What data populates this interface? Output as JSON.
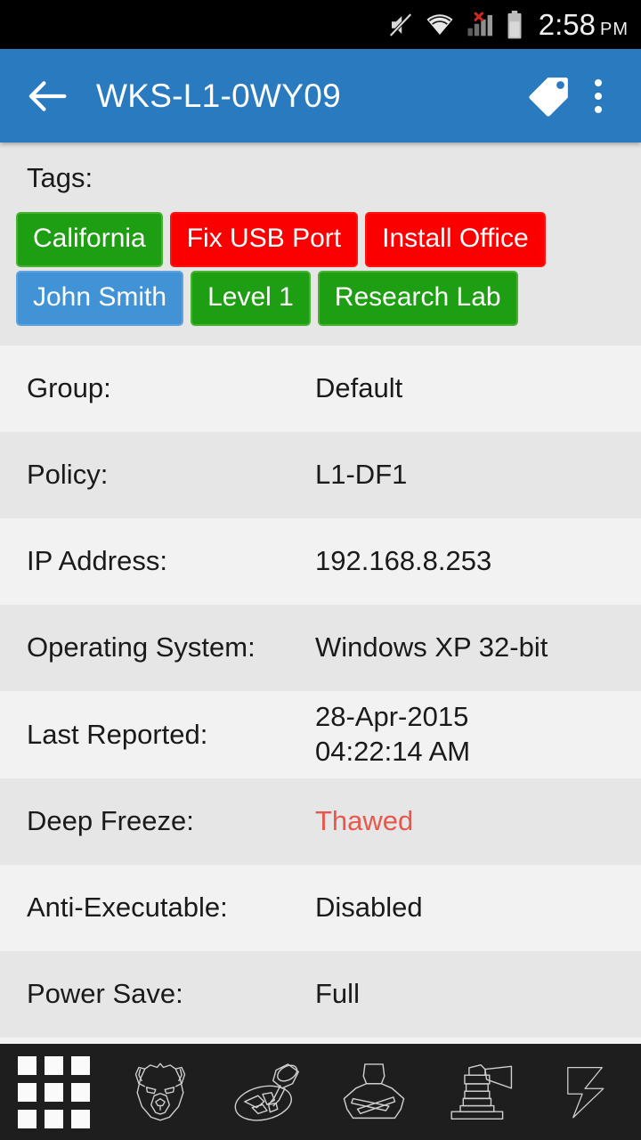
{
  "status_bar": {
    "time": "2:58",
    "meridiem": "PM",
    "icons": [
      "mute-icon",
      "wifi-icon",
      "cellular-no-service-icon",
      "battery-icon"
    ]
  },
  "app_bar": {
    "back_label": "back-arrow",
    "title": "WKS-L1-0WY09",
    "tag_action": "tag-icon",
    "overflow_action": "overflow-menu-icon"
  },
  "tags_section": {
    "label": "Tags:",
    "rows": [
      [
        {
          "text": "California",
          "color": "green"
        },
        {
          "text": "Fix USB Port",
          "color": "red"
        },
        {
          "text": "Install Office",
          "color": "red"
        }
      ],
      [
        {
          "text": "John Smith",
          "color": "blue"
        },
        {
          "text": "Level 1",
          "color": "green"
        },
        {
          "text": "Research Lab",
          "color": "green"
        }
      ]
    ],
    "colors": {
      "green": "#1e9e12",
      "red": "#fb0000",
      "blue": "#4292d6"
    }
  },
  "details": [
    {
      "label": "Group:",
      "value": "Default"
    },
    {
      "label": "Policy:",
      "value": "L1-DF1"
    },
    {
      "label": "IP Address:",
      "value": "192.168.8.253"
    },
    {
      "label": "Operating System:",
      "value": "Windows XP 32-bit"
    },
    {
      "label": "Last Reported:",
      "value": "28-Apr-2015\n04:22:14 AM"
    },
    {
      "label": "Deep Freeze:",
      "value": "Thawed",
      "status_color": "#e8574c"
    },
    {
      "label": "Anti-Executable:",
      "value": "Disabled"
    },
    {
      "label": "Power Save:",
      "value": "Full"
    }
  ],
  "bottom_bar": {
    "items": [
      {
        "icon": "apps-grid-icon"
      },
      {
        "icon": "bear-face-icon"
      },
      {
        "icon": "deep-freeze-plunger-icon"
      },
      {
        "icon": "anti-executable-person-icon"
      },
      {
        "icon": "insight-lighthouse-icon"
      },
      {
        "icon": "power-save-bolt-icon"
      }
    ]
  }
}
